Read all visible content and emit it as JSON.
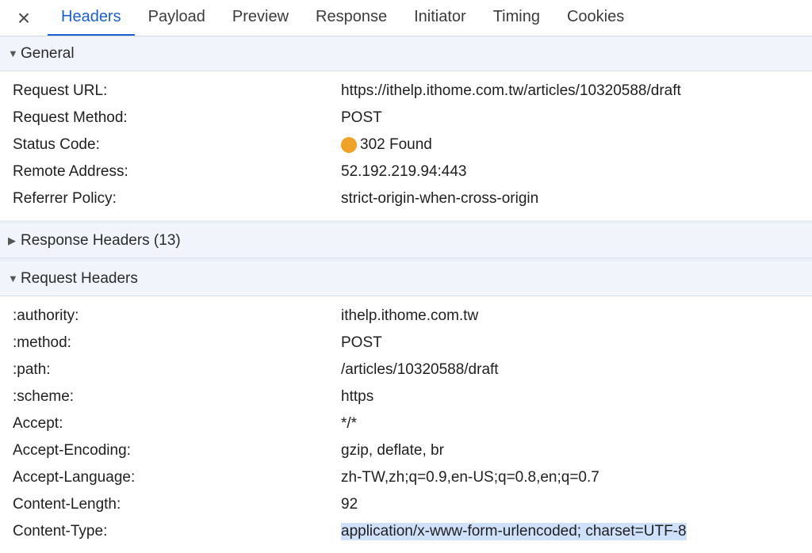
{
  "tabs": {
    "close_icon": "×",
    "items": [
      {
        "label": "Headers",
        "active": true
      },
      {
        "label": "Payload"
      },
      {
        "label": "Preview"
      },
      {
        "label": "Response"
      },
      {
        "label": "Initiator"
      },
      {
        "label": "Timing"
      },
      {
        "label": "Cookies"
      }
    ]
  },
  "general": {
    "title": "General",
    "rows": [
      {
        "key": "Request URL:",
        "value": "https://ithelp.ithome.com.tw/articles/10320588/draft"
      },
      {
        "key": "Request Method:",
        "value": "POST"
      },
      {
        "key": "Status Code:",
        "value": "302 Found",
        "status_color": "#f0a128"
      },
      {
        "key": "Remote Address:",
        "value": "52.192.219.94:443"
      },
      {
        "key": "Referrer Policy:",
        "value": "strict-origin-when-cross-origin"
      }
    ]
  },
  "response_headers": {
    "title": "Response Headers (13)"
  },
  "request_headers": {
    "title": "Request Headers",
    "rows": [
      {
        "key": ":authority:",
        "value": "ithelp.ithome.com.tw"
      },
      {
        "key": ":method:",
        "value": "POST"
      },
      {
        "key": ":path:",
        "value": "/articles/10320588/draft"
      },
      {
        "key": ":scheme:",
        "value": "https"
      },
      {
        "key": "Accept:",
        "value": "*/*"
      },
      {
        "key": "Accept-Encoding:",
        "value": "gzip, deflate, br"
      },
      {
        "key": "Accept-Language:",
        "value": "zh-TW,zh;q=0.9,en-US;q=0.8,en;q=0.7"
      },
      {
        "key": "Content-Length:",
        "value": "92"
      },
      {
        "key": "Content-Type:",
        "value": "application/x-www-form-urlencoded; charset=UTF-8"
      }
    ]
  },
  "colors": {
    "accent": "#1a5fd4",
    "status_redirect": "#f0a128",
    "selection": "#cfe0fb"
  }
}
